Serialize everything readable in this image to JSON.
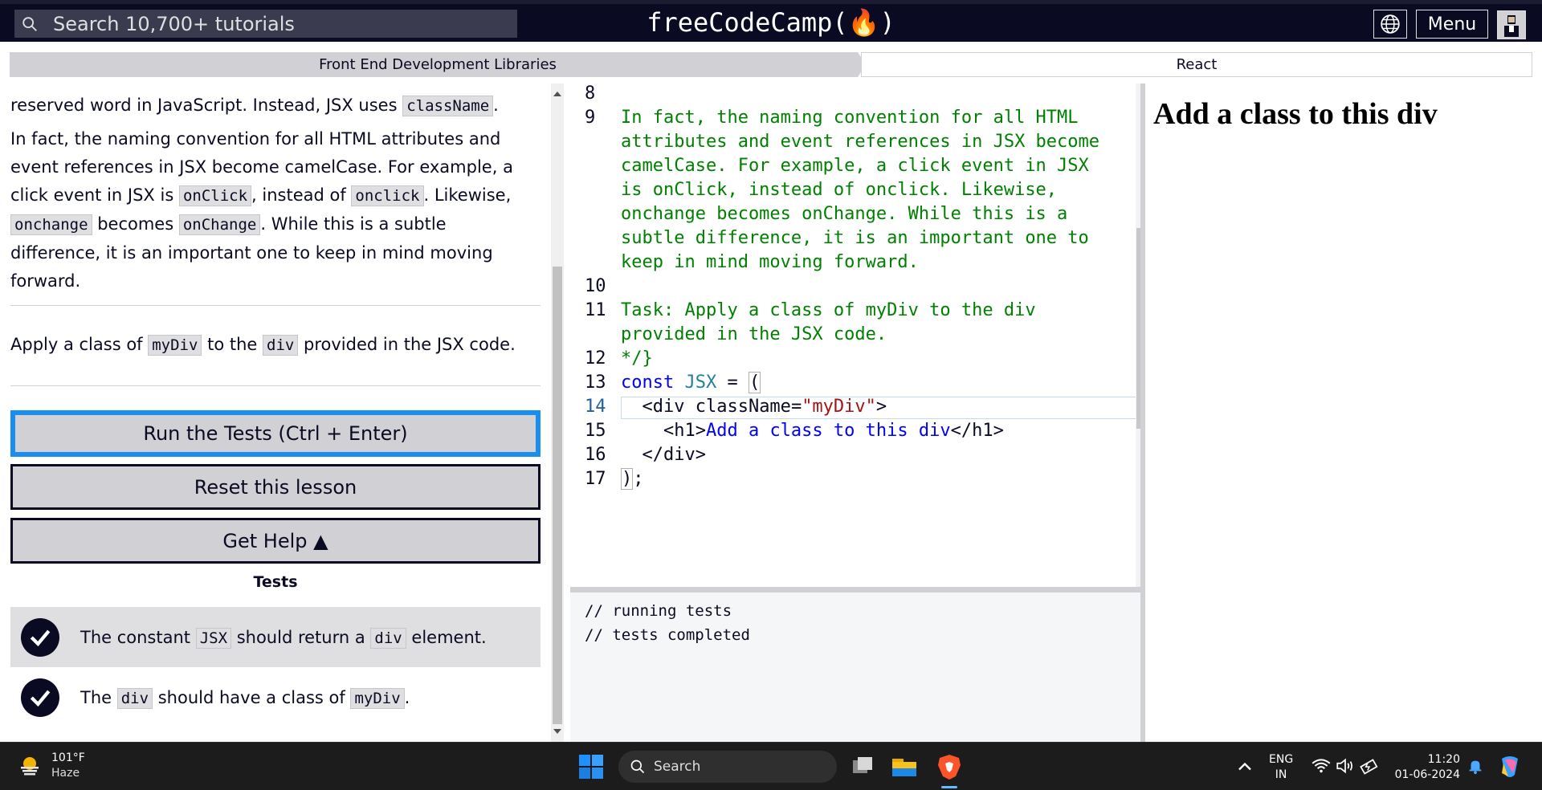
{
  "header": {
    "search_placeholder": "Search 10,700+ tutorials",
    "logo": "freeCodeCamp(🔥)",
    "menu_label": "Menu"
  },
  "breadcrumb": {
    "superblock": "Front End Development Libraries",
    "block": "React"
  },
  "instructions": {
    "p1_text": "reserved word in JavaScript. Instead, JSX uses ",
    "p1_code": "className",
    "p1_end": ".",
    "p2_a": "In fact, the naming convention for all HTML attributes and event references in JSX become camelCase. For example, a click event in JSX is ",
    "p2_code1": "onClick",
    "p2_b": ", instead of ",
    "p2_code2": "onclick",
    "p2_c": ". Likewise, ",
    "p2_code3": "onchange",
    "p2_d": " becomes ",
    "p2_code4": "onChange",
    "p2_e": ". While this is a subtle difference, it is an important one to keep in mind moving forward.",
    "task_a": "Apply a class of ",
    "task_code1": "myDiv",
    "task_b": " to the ",
    "task_code2": "div",
    "task_c": " provided in the JSX code."
  },
  "buttons": {
    "run": "Run the Tests (Ctrl + Enter)",
    "reset": "Reset this lesson",
    "help": "Get Help ▲"
  },
  "tests": {
    "title": "Tests",
    "items": [
      {
        "a": "The constant ",
        "code1": "JSX",
        "b": " should return a ",
        "code2": "div",
        "c": " element."
      },
      {
        "a": "The ",
        "code1": "div",
        "b": " should have a class of ",
        "code2": "myDiv",
        "c": "."
      }
    ]
  },
  "editor": {
    "line_numbers": [
      "8",
      "9",
      "10",
      "11",
      "12",
      "13",
      "14",
      "15",
      "16",
      "17"
    ],
    "comment_9": [
      "In fact, the naming convention for all HTML",
      "attributes and event references in JSX become",
      "camelCase. For example, a click event in JSX",
      "is onClick, instead of onclick. Likewise,",
      "onchange becomes onChange. While this is a",
      "subtle difference, it is an important one to",
      "keep in mind moving forward."
    ],
    "comment_11": [
      "Task: Apply a class of myDiv to the div",
      "provided in the JSX code."
    ],
    "line_12": "*/}",
    "l13_kw": "const",
    "l13_id": "JSX",
    "l13_rest": " = ",
    "l13_paren": "(",
    "l14_open": "  <div ",
    "l14_attr": "className",
    "l14_eq": "=",
    "l14_val": "\"myDiv\"",
    "l14_close": ">",
    "l15_open": "    <h1>",
    "l15_text": "Add a class to this div",
    "l15_close": "</h1>",
    "l16": "  </div>",
    "l17_paren": ")",
    "l17_semi": ";"
  },
  "console": {
    "lines": [
      "// running tests",
      "// tests completed"
    ]
  },
  "preview": {
    "heading": "Add a class to this div"
  },
  "taskbar": {
    "temp": "101°F",
    "condition": "Haze",
    "search": "Search",
    "lang1": "ENG",
    "lang2": "IN",
    "time": "11:20",
    "date": "01-06-2024"
  }
}
